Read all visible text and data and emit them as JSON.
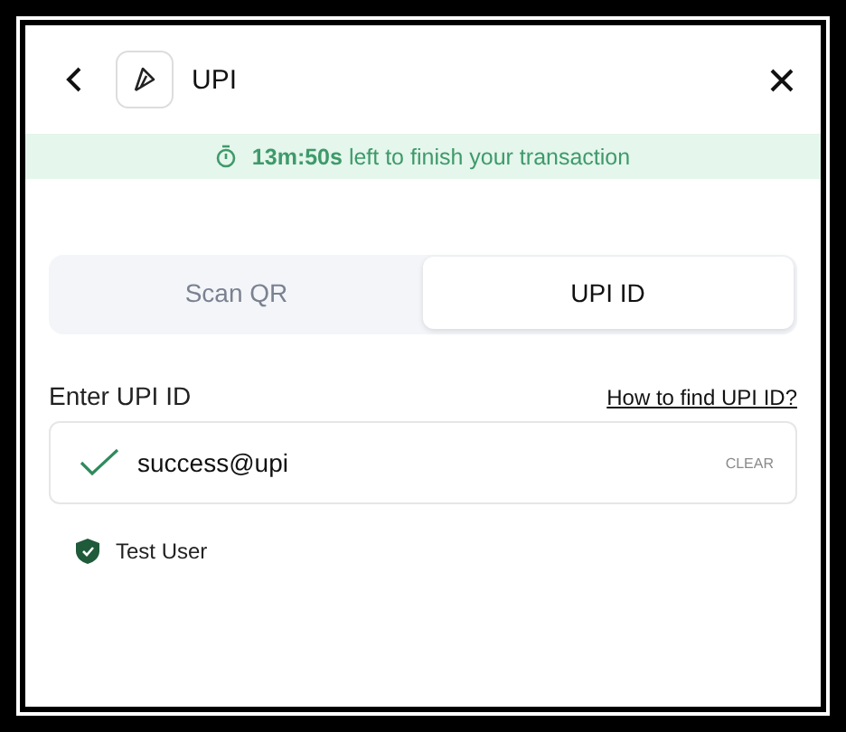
{
  "header": {
    "title": "UPI"
  },
  "timer": {
    "text": "**13m:50s** left to finish your transaction"
  },
  "tabs": [
    {
      "label": "Scan QR",
      "selected": false
    },
    {
      "label": "UPI ID",
      "selected": true
    }
  ],
  "upi_field": {
    "label": "Enter UPI ID",
    "help_link": "How to find UPI ID?",
    "value": "success@upi",
    "valid": true,
    "clear": "CLEAR"
  },
  "verified_name": {
    "text": "Test User",
    "verified": true
  }
}
